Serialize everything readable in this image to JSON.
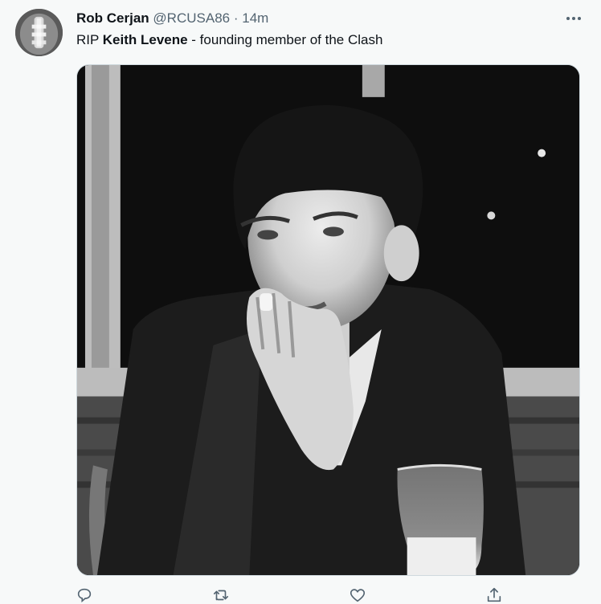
{
  "tweet": {
    "author": {
      "display_name": "Rob Cerjan",
      "handle": "@RCUSA86",
      "separator": "·",
      "timestamp": "14m"
    },
    "text": {
      "prefix": "RIP ",
      "bold": "Keith Levene",
      "suffix": " - founding member of the Clash"
    },
    "icons": {
      "more": "more-horizontal-icon",
      "reply": "reply-icon",
      "retweet": "retweet-icon",
      "like": "heart-icon",
      "share": "share-icon"
    },
    "colors": {
      "text_primary": "#0f1419",
      "text_secondary": "#536471",
      "background": "#f7f9f9"
    }
  }
}
